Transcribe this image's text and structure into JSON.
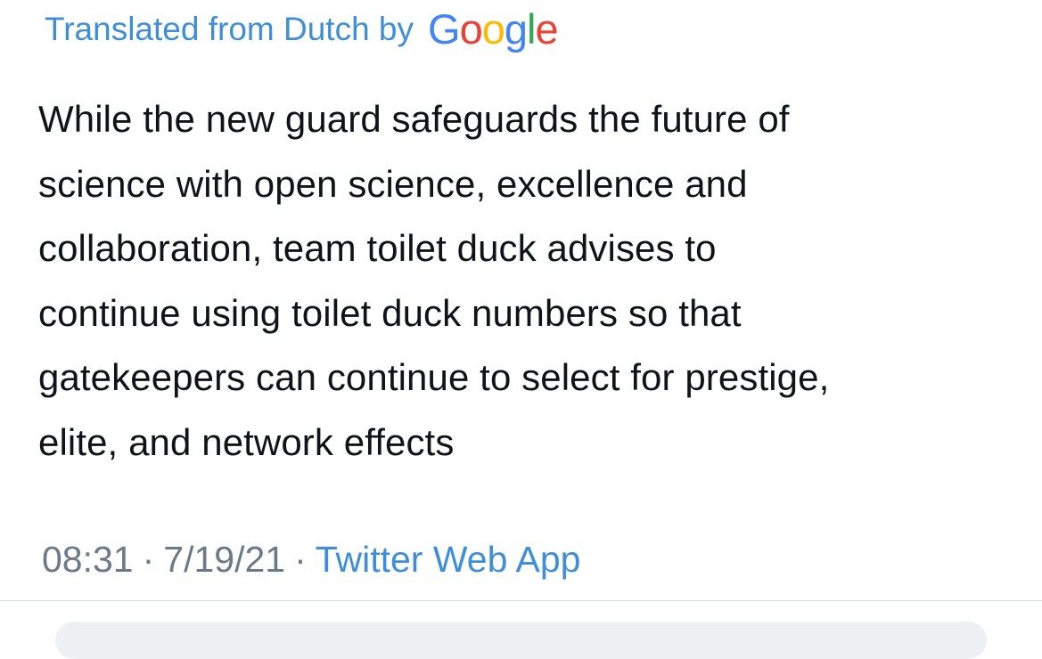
{
  "translation": {
    "label": "Translated from Dutch by",
    "logo_text": "Google",
    "logo_colors": {
      "blue": "#4285F4",
      "red": "#EA4335",
      "yellow": "#FBBC05",
      "green": "#34A853"
    }
  },
  "tweet": {
    "lines": [
      "While the new guard safeguards the future of",
      "science with open science, excellence and",
      "collaboration, team toilet duck advises to",
      "continue using toilet duck numbers so that",
      "gatekeepers can continue to select for prestige,",
      "elite, and network effects"
    ]
  },
  "meta": {
    "time": "08:31",
    "separator": "·",
    "date": "7/19/21",
    "source": "Twitter Web App"
  },
  "colors": {
    "link_blue": "#3f8fd8",
    "text_dark": "#101419",
    "meta_gray": "#6b7a88"
  }
}
